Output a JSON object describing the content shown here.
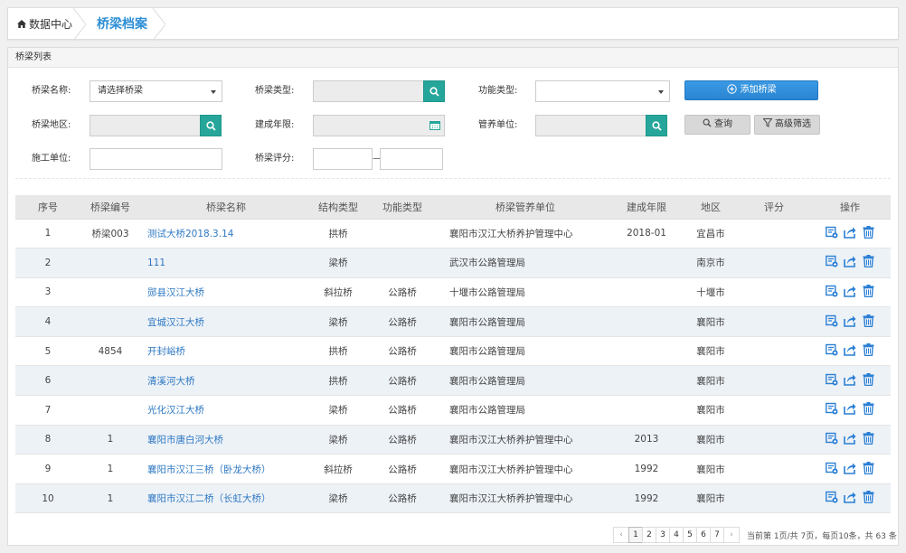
{
  "breadcrumb": {
    "home_label": "数据中心",
    "current_tab": "桥梁档案"
  },
  "panel": {
    "title": "桥梁列表"
  },
  "filters": {
    "bridge_name_label": "桥梁名称:",
    "bridge_name_value": "请选择桥梁",
    "bridge_type_label": "桥梁类型:",
    "function_type_label": "功能类型:",
    "region_label": "桥梁地区:",
    "build_year_label": "建成年限:",
    "maint_unit_label": "管养单位:",
    "construct_unit_label": "施工单位:",
    "rating_label": "桥梁评分:",
    "rating_sep": "—"
  },
  "buttons": {
    "add": "添加桥梁",
    "query": "查询",
    "advanced": "高级筛选"
  },
  "table": {
    "headers": [
      "序号",
      "桥梁编号",
      "桥梁名称",
      "结构类型",
      "功能类型",
      "桥梁管养单位",
      "建成年限",
      "地区",
      "评分",
      "操作"
    ],
    "rows": [
      {
        "no": "1",
        "code": "桥梁003",
        "name": "测试大桥2018.3.14",
        "struct": "拱桥",
        "func": "",
        "unit": "襄阳市汉江大桥养护管理中心",
        "year": "2018-01",
        "region": "宜昌市",
        "score": ""
      },
      {
        "no": "2",
        "code": "",
        "name": "111",
        "struct": "梁桥",
        "func": "",
        "unit": "武汉市公路管理局",
        "year": "",
        "region": "南京市",
        "score": ""
      },
      {
        "no": "3",
        "code": "",
        "name": "郧县汉江大桥",
        "struct": "斜拉桥",
        "func": "公路桥",
        "unit": "十堰市公路管理局",
        "year": "",
        "region": "十堰市",
        "score": ""
      },
      {
        "no": "4",
        "code": "",
        "name": "宜城汉江大桥",
        "struct": "梁桥",
        "func": "公路桥",
        "unit": "襄阳市公路管理局",
        "year": "",
        "region": "襄阳市",
        "score": ""
      },
      {
        "no": "5",
        "code": "4854",
        "name": "开封峪桥",
        "struct": "拱桥",
        "func": "公路桥",
        "unit": "襄阳市公路管理局",
        "year": "",
        "region": "襄阳市",
        "score": ""
      },
      {
        "no": "6",
        "code": "",
        "name": "清溪河大桥",
        "struct": "拱桥",
        "func": "公路桥",
        "unit": "襄阳市公路管理局",
        "year": "",
        "region": "襄阳市",
        "score": ""
      },
      {
        "no": "7",
        "code": "",
        "name": "光化汉江大桥",
        "struct": "梁桥",
        "func": "公路桥",
        "unit": "襄阳市公路管理局",
        "year": "",
        "region": "襄阳市",
        "score": ""
      },
      {
        "no": "8",
        "code": "1",
        "name": "襄阳市唐白河大桥",
        "struct": "梁桥",
        "func": "公路桥",
        "unit": "襄阳市汉江大桥养护管理中心",
        "year": "2013",
        "region": "襄阳市",
        "score": ""
      },
      {
        "no": "9",
        "code": "1",
        "name": "襄阳市汉江三桥（卧龙大桥）",
        "struct": "斜拉桥",
        "func": "公路桥",
        "unit": "襄阳市汉江大桥养护管理中心",
        "year": "1992",
        "region": "襄阳市",
        "score": ""
      },
      {
        "no": "10",
        "code": "1",
        "name": "襄阳市汉江二桥（长虹大桥）",
        "struct": "梁桥",
        "func": "公路桥",
        "unit": "襄阳市汉江大桥养护管理中心",
        "year": "1992",
        "region": "襄阳市",
        "score": ""
      }
    ]
  },
  "pagination": {
    "prev": "‹",
    "pages": [
      "1",
      "2",
      "3",
      "4",
      "5",
      "6",
      "7"
    ],
    "current_page": "1",
    "next": "›",
    "info": "当前第 1页/共 7页，每页10条，共 63 条"
  },
  "colors": {
    "accent": "#2e8fd6",
    "search_btn": "#26a69a",
    "link": "#2e78c2",
    "op_icon": "#2a7fd4"
  },
  "icons": {
    "home": "home-icon",
    "search": "search-icon",
    "calendar": "calendar-icon",
    "add": "plus-circle-icon",
    "query": "search-icon",
    "filter": "filter-icon",
    "edit": "edit-icon",
    "export": "share-icon",
    "delete": "trash-icon"
  }
}
